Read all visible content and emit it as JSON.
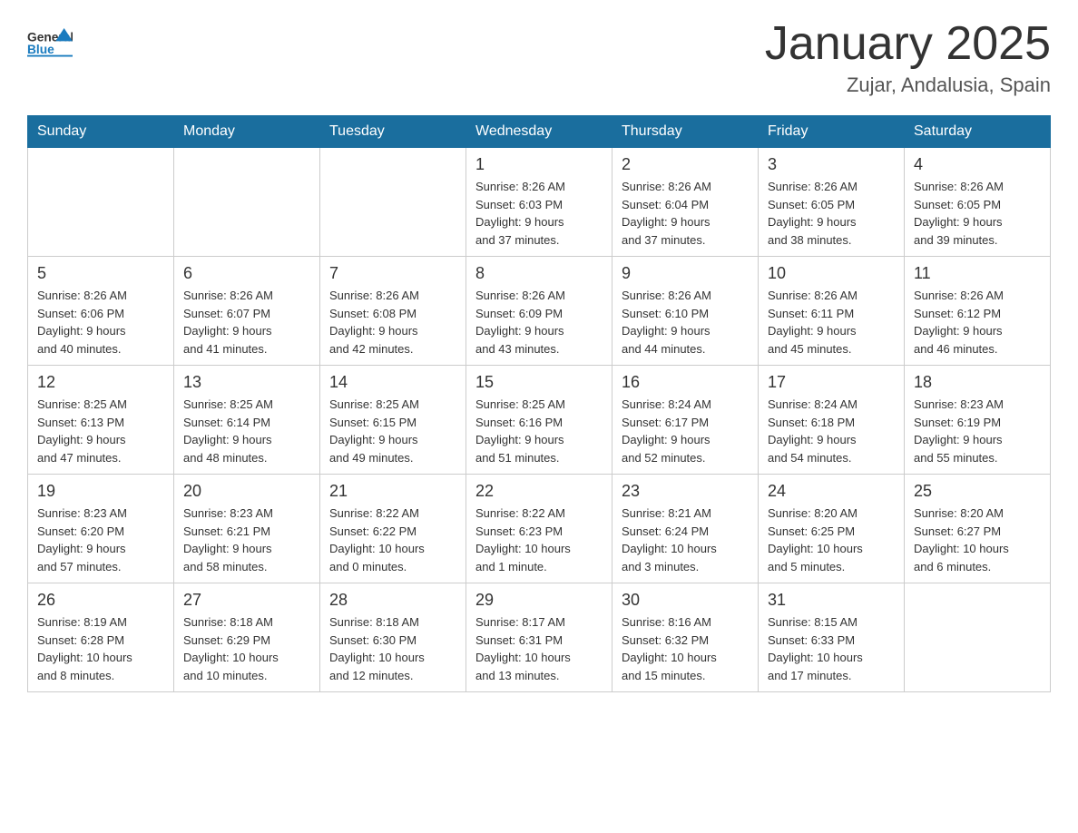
{
  "header": {
    "logo": {
      "general": "General",
      "blue": "Blue"
    },
    "title": "January 2025",
    "subtitle": "Zujar, Andalusia, Spain"
  },
  "days_of_week": [
    "Sunday",
    "Monday",
    "Tuesday",
    "Wednesday",
    "Thursday",
    "Friday",
    "Saturday"
  ],
  "weeks": [
    [
      {
        "day": "",
        "info": ""
      },
      {
        "day": "",
        "info": ""
      },
      {
        "day": "",
        "info": ""
      },
      {
        "day": "1",
        "info": "Sunrise: 8:26 AM\nSunset: 6:03 PM\nDaylight: 9 hours\nand 37 minutes."
      },
      {
        "day": "2",
        "info": "Sunrise: 8:26 AM\nSunset: 6:04 PM\nDaylight: 9 hours\nand 37 minutes."
      },
      {
        "day": "3",
        "info": "Sunrise: 8:26 AM\nSunset: 6:05 PM\nDaylight: 9 hours\nand 38 minutes."
      },
      {
        "day": "4",
        "info": "Sunrise: 8:26 AM\nSunset: 6:05 PM\nDaylight: 9 hours\nand 39 minutes."
      }
    ],
    [
      {
        "day": "5",
        "info": "Sunrise: 8:26 AM\nSunset: 6:06 PM\nDaylight: 9 hours\nand 40 minutes."
      },
      {
        "day": "6",
        "info": "Sunrise: 8:26 AM\nSunset: 6:07 PM\nDaylight: 9 hours\nand 41 minutes."
      },
      {
        "day": "7",
        "info": "Sunrise: 8:26 AM\nSunset: 6:08 PM\nDaylight: 9 hours\nand 42 minutes."
      },
      {
        "day": "8",
        "info": "Sunrise: 8:26 AM\nSunset: 6:09 PM\nDaylight: 9 hours\nand 43 minutes."
      },
      {
        "day": "9",
        "info": "Sunrise: 8:26 AM\nSunset: 6:10 PM\nDaylight: 9 hours\nand 44 minutes."
      },
      {
        "day": "10",
        "info": "Sunrise: 8:26 AM\nSunset: 6:11 PM\nDaylight: 9 hours\nand 45 minutes."
      },
      {
        "day": "11",
        "info": "Sunrise: 8:26 AM\nSunset: 6:12 PM\nDaylight: 9 hours\nand 46 minutes."
      }
    ],
    [
      {
        "day": "12",
        "info": "Sunrise: 8:25 AM\nSunset: 6:13 PM\nDaylight: 9 hours\nand 47 minutes."
      },
      {
        "day": "13",
        "info": "Sunrise: 8:25 AM\nSunset: 6:14 PM\nDaylight: 9 hours\nand 48 minutes."
      },
      {
        "day": "14",
        "info": "Sunrise: 8:25 AM\nSunset: 6:15 PM\nDaylight: 9 hours\nand 49 minutes."
      },
      {
        "day": "15",
        "info": "Sunrise: 8:25 AM\nSunset: 6:16 PM\nDaylight: 9 hours\nand 51 minutes."
      },
      {
        "day": "16",
        "info": "Sunrise: 8:24 AM\nSunset: 6:17 PM\nDaylight: 9 hours\nand 52 minutes."
      },
      {
        "day": "17",
        "info": "Sunrise: 8:24 AM\nSunset: 6:18 PM\nDaylight: 9 hours\nand 54 minutes."
      },
      {
        "day": "18",
        "info": "Sunrise: 8:23 AM\nSunset: 6:19 PM\nDaylight: 9 hours\nand 55 minutes."
      }
    ],
    [
      {
        "day": "19",
        "info": "Sunrise: 8:23 AM\nSunset: 6:20 PM\nDaylight: 9 hours\nand 57 minutes."
      },
      {
        "day": "20",
        "info": "Sunrise: 8:23 AM\nSunset: 6:21 PM\nDaylight: 9 hours\nand 58 minutes."
      },
      {
        "day": "21",
        "info": "Sunrise: 8:22 AM\nSunset: 6:22 PM\nDaylight: 10 hours\nand 0 minutes."
      },
      {
        "day": "22",
        "info": "Sunrise: 8:22 AM\nSunset: 6:23 PM\nDaylight: 10 hours\nand 1 minute."
      },
      {
        "day": "23",
        "info": "Sunrise: 8:21 AM\nSunset: 6:24 PM\nDaylight: 10 hours\nand 3 minutes."
      },
      {
        "day": "24",
        "info": "Sunrise: 8:20 AM\nSunset: 6:25 PM\nDaylight: 10 hours\nand 5 minutes."
      },
      {
        "day": "25",
        "info": "Sunrise: 8:20 AM\nSunset: 6:27 PM\nDaylight: 10 hours\nand 6 minutes."
      }
    ],
    [
      {
        "day": "26",
        "info": "Sunrise: 8:19 AM\nSunset: 6:28 PM\nDaylight: 10 hours\nand 8 minutes."
      },
      {
        "day": "27",
        "info": "Sunrise: 8:18 AM\nSunset: 6:29 PM\nDaylight: 10 hours\nand 10 minutes."
      },
      {
        "day": "28",
        "info": "Sunrise: 8:18 AM\nSunset: 6:30 PM\nDaylight: 10 hours\nand 12 minutes."
      },
      {
        "day": "29",
        "info": "Sunrise: 8:17 AM\nSunset: 6:31 PM\nDaylight: 10 hours\nand 13 minutes."
      },
      {
        "day": "30",
        "info": "Sunrise: 8:16 AM\nSunset: 6:32 PM\nDaylight: 10 hours\nand 15 minutes."
      },
      {
        "day": "31",
        "info": "Sunrise: 8:15 AM\nSunset: 6:33 PM\nDaylight: 10 hours\nand 17 minutes."
      },
      {
        "day": "",
        "info": ""
      }
    ]
  ]
}
